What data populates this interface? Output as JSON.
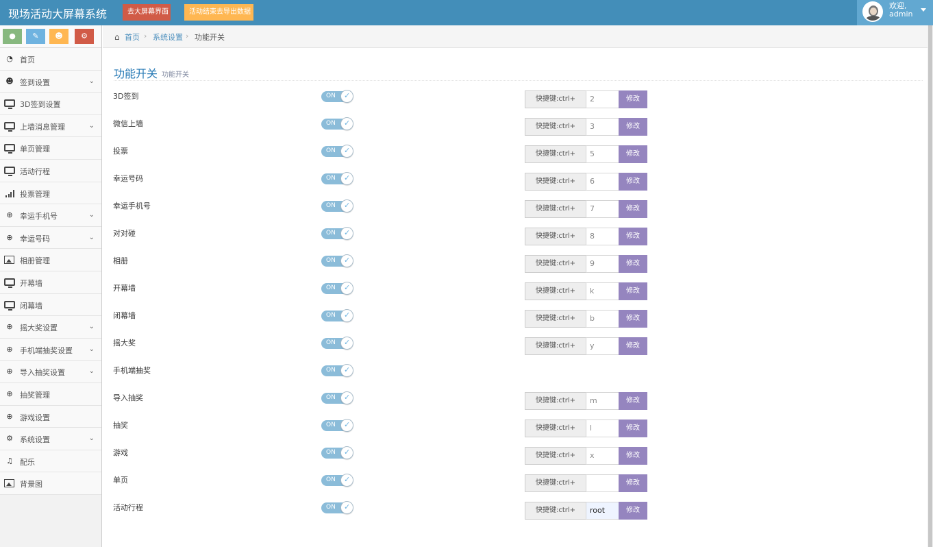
{
  "app": {
    "title": "现场活动大屏幕系统",
    "btn_big_screen": "去大屏幕界面",
    "btn_export": "活动结束去导出数据"
  },
  "user": {
    "welcome": "欢迎,",
    "name": "admin"
  },
  "sidebar": {
    "shortcuts": [
      {
        "icon": "comment-icon",
        "color": "#87b87f"
      },
      {
        "icon": "pencil-icon",
        "color": "#6fb3e0"
      },
      {
        "icon": "users-icon",
        "color": "#ffb752"
      },
      {
        "icon": "cogs-icon",
        "color": "#d15b47"
      }
    ],
    "items": [
      {
        "label": "首页",
        "icon": "dashboard-icon",
        "has_submenu": false
      },
      {
        "label": "签到设置",
        "icon": "users-icon",
        "has_submenu": true
      },
      {
        "label": "3D签到设置",
        "icon": "monitor-icon",
        "has_submenu": false
      },
      {
        "label": "上墙消息管理",
        "icon": "monitor-icon",
        "has_submenu": true
      },
      {
        "label": "单页管理",
        "icon": "monitor-icon",
        "has_submenu": false
      },
      {
        "label": "活动行程",
        "icon": "monitor-icon",
        "has_submenu": false
      },
      {
        "label": "投票管理",
        "icon": "signal-icon",
        "has_submenu": false
      },
      {
        "label": "幸运手机号",
        "icon": "gift-icon",
        "has_submenu": true
      },
      {
        "label": "幸运号码",
        "icon": "gift-icon",
        "has_submenu": true
      },
      {
        "label": "相册管理",
        "icon": "picture-icon",
        "has_submenu": false
      },
      {
        "label": "开幕墙",
        "icon": "monitor-icon",
        "has_submenu": false
      },
      {
        "label": "闭幕墙",
        "icon": "monitor-icon",
        "has_submenu": false
      },
      {
        "label": "摇大奖设置",
        "icon": "gift-icon",
        "has_submenu": true
      },
      {
        "label": "手机端抽奖设置",
        "icon": "gift-icon",
        "has_submenu": true
      },
      {
        "label": "导入抽奖设置",
        "icon": "gift-icon",
        "has_submenu": true
      },
      {
        "label": "抽奖管理",
        "icon": "gift-icon",
        "has_submenu": false
      },
      {
        "label": "游戏设置",
        "icon": "gift-icon",
        "has_submenu": false
      },
      {
        "label": "系统设置",
        "icon": "cog-icon",
        "has_submenu": true
      },
      {
        "label": "配乐",
        "icon": "music-icon",
        "has_submenu": false
      },
      {
        "label": "背景图",
        "icon": "picture-icon",
        "has_submenu": false
      }
    ]
  },
  "breadcrumb": {
    "home": "首页",
    "sep": "›",
    "parent": "系统设置",
    "current": "功能开关"
  },
  "page": {
    "title": "功能开关",
    "subtitle": "功能开关"
  },
  "hotkey_label": "快捷键:ctrl+",
  "modify_label": "修改",
  "toggle_on": "ON",
  "features": [
    {
      "name": "3D签到",
      "enabled": true,
      "hotkey": "2",
      "has_hotkey": true
    },
    {
      "name": "微信上墙",
      "enabled": true,
      "hotkey": "3",
      "has_hotkey": true
    },
    {
      "name": "投票",
      "enabled": true,
      "hotkey": "5",
      "has_hotkey": true
    },
    {
      "name": "幸运号码",
      "enabled": true,
      "hotkey": "6",
      "has_hotkey": true
    },
    {
      "name": "幸运手机号",
      "enabled": true,
      "hotkey": "7",
      "has_hotkey": true
    },
    {
      "name": "对对碰",
      "enabled": true,
      "hotkey": "8",
      "has_hotkey": true
    },
    {
      "name": "相册",
      "enabled": true,
      "hotkey": "9",
      "has_hotkey": true
    },
    {
      "name": "开幕墙",
      "enabled": true,
      "hotkey": "k",
      "has_hotkey": true
    },
    {
      "name": "闭幕墙",
      "enabled": true,
      "hotkey": "b",
      "has_hotkey": true
    },
    {
      "name": "摇大奖",
      "enabled": true,
      "hotkey": "y",
      "has_hotkey": true
    },
    {
      "name": "手机端抽奖",
      "enabled": true,
      "hotkey": "",
      "has_hotkey": false
    },
    {
      "name": "导入抽奖",
      "enabled": true,
      "hotkey": "m",
      "has_hotkey": true
    },
    {
      "name": "抽奖",
      "enabled": true,
      "hotkey": "l",
      "has_hotkey": true
    },
    {
      "name": "游戏",
      "enabled": true,
      "hotkey": "x",
      "has_hotkey": true
    },
    {
      "name": "单页",
      "enabled": true,
      "hotkey": "",
      "has_hotkey": true
    },
    {
      "name": "活动行程",
      "enabled": true,
      "hotkey": "root",
      "has_hotkey": true
    }
  ]
}
